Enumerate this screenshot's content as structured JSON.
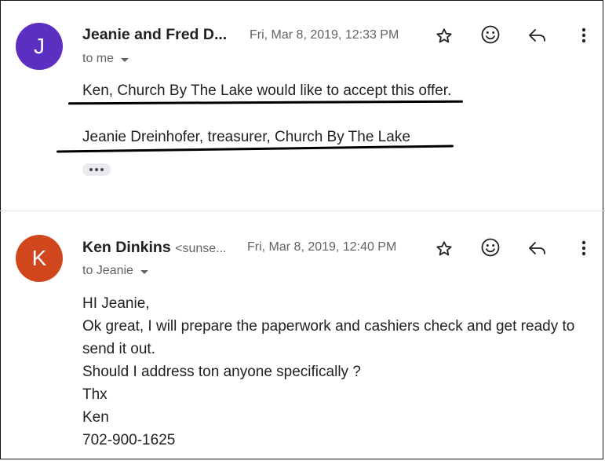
{
  "messages": [
    {
      "avatar_letter": "J",
      "avatar_color": "#5b2fbf",
      "sender_name": "Jeanie and Fred D...",
      "sender_email": "",
      "date": "Fri, Mar 8, 2019, 12:33 PM",
      "recipient": "to me",
      "body": [
        "Ken, Church By The Lake would like to accept this offer.",
        "Jeanie Dreinhofer, treasurer, Church By The Lake"
      ]
    },
    {
      "avatar_letter": "K",
      "avatar_color": "#d1471d",
      "sender_name": "Ken Dinkins",
      "sender_email": "<sunse...",
      "date": "Fri, Mar 8, 2019, 12:40 PM",
      "recipient": "to Jeanie",
      "body": [
        "HI Jeanie,",
        "Ok great, I will prepare the paperwork and cashiers check and get ready to",
        "send it out.",
        "Should I address ton anyone specifically ?",
        "Thx",
        "Ken",
        "702-900-1625"
      ]
    }
  ],
  "icons": {
    "star": "star-icon",
    "emoji": "emoji-icon",
    "reply": "reply-icon",
    "more": "more-vert-icon"
  }
}
